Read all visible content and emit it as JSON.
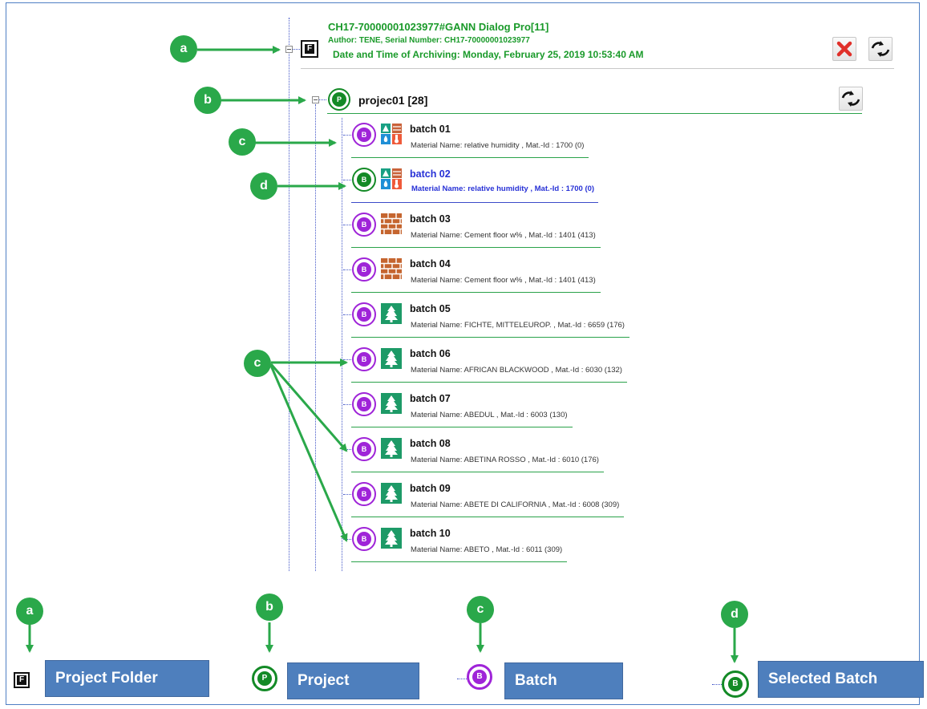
{
  "archive": {
    "title": "CH17-70000001023977#GANN Dialog Pro[11]",
    "author_line": "Author: TENE, Serial Number: CH17-70000001023977",
    "date_line": "Date and Time of Archiving:  Monday, February 25, 2019 10:53:40 AM",
    "folder_icon_letter": "F"
  },
  "project": {
    "label": "projec01 [28]",
    "icon_letter": "P"
  },
  "batch_icon_letter": "B",
  "batches": [
    {
      "name": "batch 01",
      "material": "Material Name: relative humidity ,  Mat.-Id :  1700 (0)",
      "icon": "humidity-icon",
      "selected": false
    },
    {
      "name": "batch 02",
      "material": "Material Name: relative humidity ,  Mat.-Id :  1700 (0)",
      "icon": "humidity-icon",
      "selected": true
    },
    {
      "name": "batch 03",
      "material": "Material Name: Cement floor w% ,  Mat.-Id :  1401 (413)",
      "icon": "brick-icon",
      "selected": false
    },
    {
      "name": "batch 04",
      "material": "Material Name: Cement floor w% ,  Mat.-Id :  1401 (413)",
      "icon": "brick-icon",
      "selected": false
    },
    {
      "name": "batch 05",
      "material": "Material Name: FICHTE, MITTELEUROP. ,  Mat.-Id :  6659 (176)",
      "icon": "tree-icon",
      "selected": false
    },
    {
      "name": "batch 06",
      "material": "Material Name: AFRICAN BLACKWOOD ,  Mat.-Id :  6030 (132)",
      "icon": "tree-icon",
      "selected": false
    },
    {
      "name": "batch 07",
      "material": "Material Name: ABEDUL ,  Mat.-Id :  6003 (130)",
      "icon": "tree-icon",
      "selected": false
    },
    {
      "name": "batch 08",
      "material": "Material Name: ABETINA ROSSO ,  Mat.-Id :  6010 (176)",
      "icon": "tree-icon",
      "selected": false
    },
    {
      "name": "batch 09",
      "material": "Material Name: ABETE DI CALIFORNIA ,  Mat.-Id :  6008 (309)",
      "icon": "tree-icon",
      "selected": false
    },
    {
      "name": "batch 10",
      "material": "Material Name: ABETO ,  Mat.-Id :  6011 (309)",
      "icon": "tree-icon",
      "selected": false
    }
  ],
  "callouts": {
    "a": "a",
    "b": "b",
    "c": "c",
    "d": "d"
  },
  "legend": {
    "project_folder": "Project Folder",
    "project": "Project",
    "batch": "Batch",
    "selected_batch": "Selected Batch"
  },
  "colors": {
    "callout_green": "#2aa84a",
    "batch_purple": "#9f24d8",
    "selected_green": "#138a26",
    "selected_text_blue": "#2731d6",
    "legend_blue": "#4e7fbd"
  }
}
